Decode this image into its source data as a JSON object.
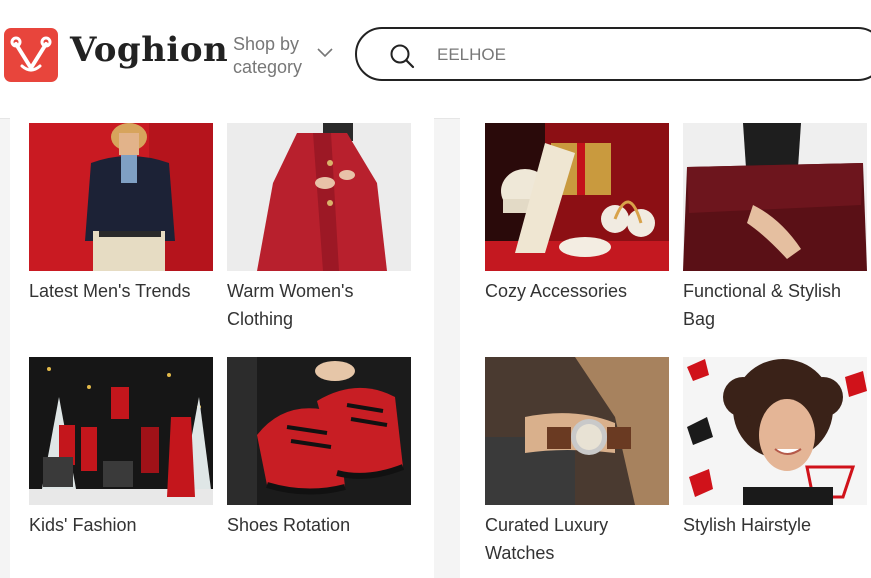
{
  "brand": {
    "name": "Voghion",
    "accent": "#e8453c"
  },
  "header": {
    "shop_by_category": "Shop by category",
    "search_placeholder": "EELHOE"
  },
  "categories": [
    {
      "label": "Latest Men's Trends",
      "icon": "men-fashion-photo"
    },
    {
      "label": "Warm Women's Clothing",
      "icon": "women-coat-photo"
    },
    {
      "label": "Cozy Accessories",
      "icon": "winter-accessories-photo"
    },
    {
      "label": "Functional & Stylish Bag",
      "icon": "leather-bag-photo"
    },
    {
      "label": "Kids' Fashion",
      "icon": "family-christmas-photo"
    },
    {
      "label": "Shoes Rotation",
      "icon": "sneakers-photo"
    },
    {
      "label": "Curated Luxury Watches",
      "icon": "wristwatch-photo"
    },
    {
      "label": "Stylish Hairstyle",
      "icon": "curly-hair-photo"
    }
  ]
}
